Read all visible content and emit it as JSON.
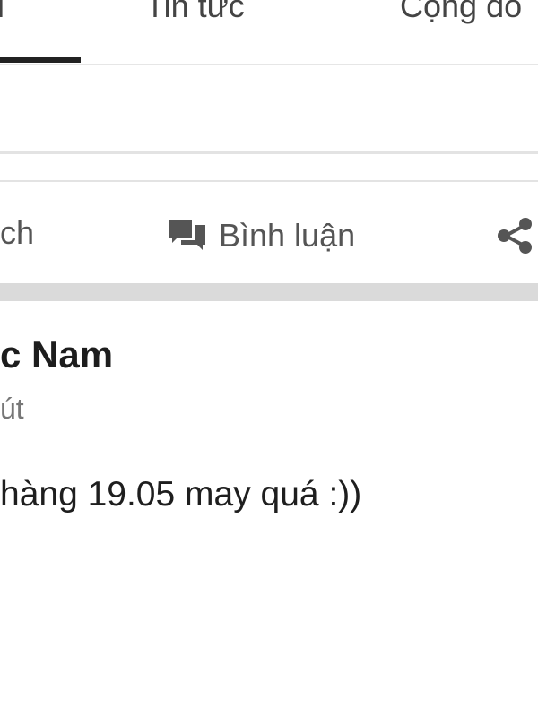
{
  "tabs": {
    "items": [
      {
        "label": "ı",
        "active": true
      },
      {
        "label": "Tin tức",
        "active": false
      },
      {
        "label": "Cộng đồ",
        "active": false
      }
    ]
  },
  "actions": {
    "left_partial_label": "ch",
    "comment_label": "Bình luận",
    "comment_icon": "comment-icon",
    "share_icon": "share-icon"
  },
  "post": {
    "author": "c Nam",
    "time": "út",
    "body": "hàng 19.05 may quá :))"
  },
  "colors": {
    "background": "#ffffff",
    "divider": "#e3e3e3",
    "band": "#dadada",
    "text_primary": "#1d1d1d",
    "text_secondary": "#777777",
    "icon": "#555555",
    "active_tab": "#222222"
  }
}
